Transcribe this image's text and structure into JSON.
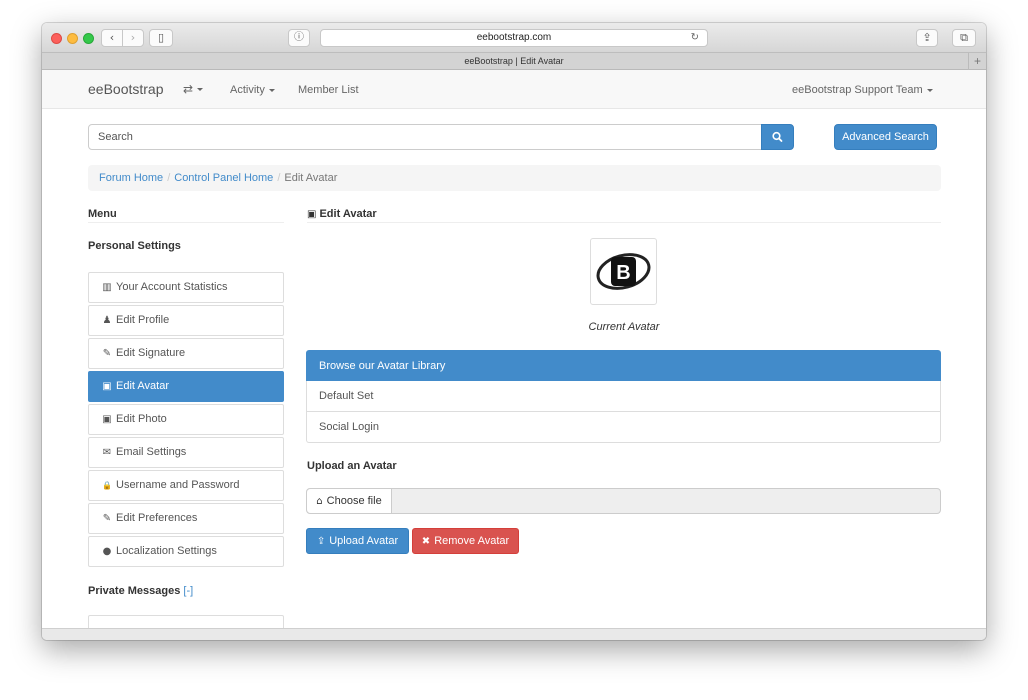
{
  "browser": {
    "url": "eebootstrap.com",
    "tab_title": "eeBootstrap | Edit Avatar",
    "back_glyph": "‹",
    "forward_glyph": "›",
    "reload_glyph": "↻",
    "info_glyph": "ⓘ",
    "new_tab_glyph": "+",
    "share_glyph": "⇪",
    "tabs_glyph": "⧉",
    "sidebar_glyph": "▯"
  },
  "navbar": {
    "brand": "eeBootstrap",
    "swap_glyph": "⇄",
    "activity": "Activity",
    "member_list": "Member List",
    "user_menu": "eeBootstrap Support Team"
  },
  "search": {
    "placeholder": "Search",
    "advanced_label": "Advanced Search"
  },
  "breadcrumb": {
    "items": [
      "Forum Home",
      "Control Panel Home"
    ],
    "separator": "/",
    "active": "Edit Avatar"
  },
  "sidebar": {
    "menu_heading": "Menu",
    "personal_heading": "Personal Settings",
    "items": [
      {
        "label": "Your Account Statistics",
        "icon": "stats-icon",
        "glyph": "▥"
      },
      {
        "label": "Edit Profile",
        "icon": "user-icon",
        "glyph": "♟"
      },
      {
        "label": "Edit Signature",
        "icon": "pencil-icon",
        "glyph": "✎"
      },
      {
        "label": "Edit Avatar",
        "icon": "picture-icon",
        "glyph": "▣",
        "active": true
      },
      {
        "label": "Edit Photo",
        "icon": "picture-icon",
        "glyph": "▣"
      },
      {
        "label": "Email Settings",
        "icon": "envelope-icon",
        "glyph": "✉"
      },
      {
        "label": "Username and Password",
        "icon": "lock-icon",
        "glyph": "🔒"
      },
      {
        "label": "Edit Preferences",
        "icon": "pencil-icon",
        "glyph": "✎"
      },
      {
        "label": "Localization Settings",
        "icon": "globe-icon",
        "glyph": "●"
      }
    ],
    "private_heading": "Private Messages",
    "private_toggle": "[-]"
  },
  "main": {
    "heading": "Edit Avatar",
    "heading_glyph": "▣",
    "avatar_caption": "Current Avatar",
    "avatar_letter": "B",
    "library": [
      {
        "label": "Browse our Avatar Library",
        "active": true
      },
      {
        "label": "Default Set"
      },
      {
        "label": "Social Login"
      }
    ],
    "upload_heading": "Upload an Avatar",
    "choose_file": "Choose file",
    "choose_file_glyph": "⌂",
    "upload_button": "Upload Avatar",
    "upload_glyph": "⇪",
    "remove_button": "Remove Avatar",
    "remove_glyph": "✖"
  },
  "colors": {
    "primary": "#428bca",
    "danger": "#d9534f",
    "link": "#428bca"
  }
}
